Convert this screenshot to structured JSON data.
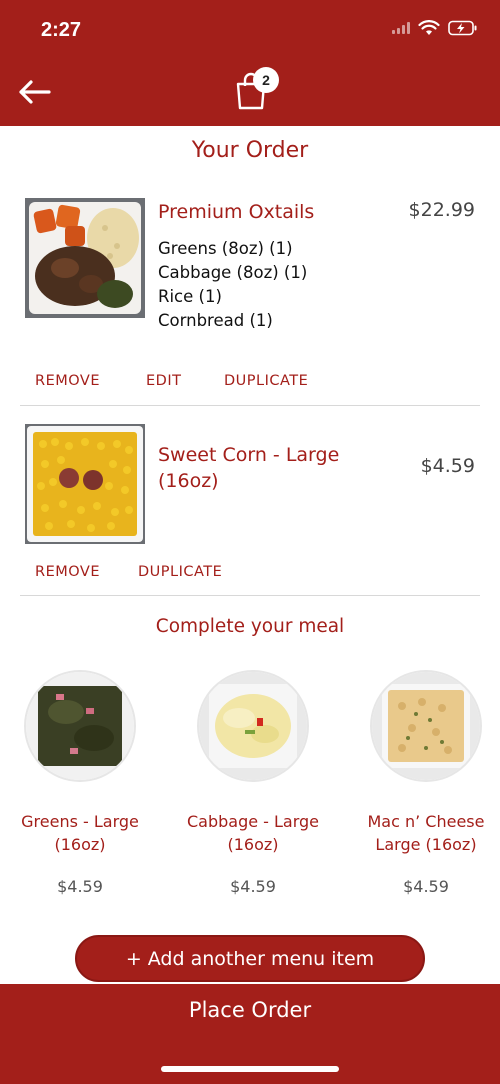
{
  "status_bar": {
    "time": "2:27"
  },
  "header": {
    "back_icon": "arrow-left-icon",
    "cart_icon": "shopping-bag-icon",
    "cart_count": "2"
  },
  "order": {
    "title": "Your Order",
    "items": [
      {
        "name": "Premium Oxtails",
        "price": "$22.99",
        "modifiers": [
          "Greens (8oz) (1)",
          "Cabbage (8oz) (1)",
          "Rice (1)",
          "Cornbread (1)"
        ],
        "actions": [
          "REMOVE",
          "EDIT",
          "DUPLICATE"
        ]
      },
      {
        "name": "Sweet Corn - Large (16oz)",
        "price": "$4.59",
        "actions": [
          "REMOVE",
          "DUPLICATE"
        ]
      }
    ]
  },
  "suggestions": {
    "title": "Complete your meal",
    "items": [
      {
        "name": "Greens - Large (16oz)",
        "price": "$4.59"
      },
      {
        "name": "Cabbage - Large (16oz)",
        "price": "$4.59"
      },
      {
        "name": "Mac n’ Cheese Large (16oz)",
        "price": "$4.59"
      }
    ]
  },
  "add_item_button": "+ Add another menu item",
  "place_order_button": "Place Order",
  "colors": {
    "brand": "#A31F1A",
    "background": "#FFFFFF"
  }
}
